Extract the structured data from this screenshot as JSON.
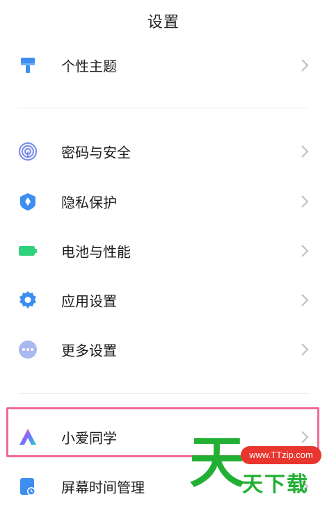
{
  "header": {
    "title": "设置"
  },
  "groups": [
    {
      "items": [
        {
          "label": "个性主题",
          "icon": "paint-brush-icon"
        }
      ]
    },
    {
      "items": [
        {
          "label": "密码与安全",
          "icon": "fingerprint-icon"
        },
        {
          "label": "隐私保护",
          "icon": "privacy-shield-icon"
        },
        {
          "label": "电池与性能",
          "icon": "battery-icon"
        },
        {
          "label": "应用设置",
          "icon": "gear-icon"
        },
        {
          "label": "更多设置",
          "icon": "more-dots-icon"
        }
      ]
    },
    {
      "items": [
        {
          "label": "小爱同学",
          "icon": "xiaoai-assistant-icon"
        },
        {
          "label": "屏幕时间管理",
          "icon": "screen-time-icon"
        }
      ]
    }
  ],
  "colors": {
    "accent_blue": "#3d8ef0",
    "battery_green": "#2fd27a",
    "highlight_pink": "#ef6a94",
    "watermark_green": "#21b033",
    "watermark_red": "#e8352d"
  },
  "watermark": {
    "url": "www.TTzip.com",
    "big_char": "天",
    "text": "天下载"
  }
}
